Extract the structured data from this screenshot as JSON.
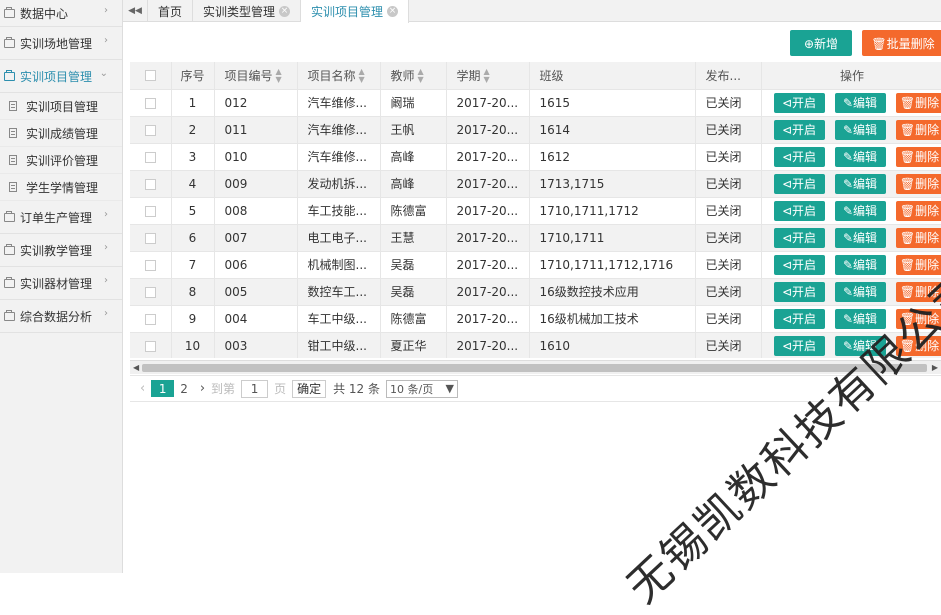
{
  "sidebar": {
    "items": [
      {
        "label": "数据中心",
        "arrow": "›"
      },
      {
        "label": "实训场地管理",
        "arrow": "›"
      },
      {
        "label": "实训项目管理",
        "arrow": "⌄",
        "active": true
      },
      {
        "label": "实训项目管理",
        "sub": true
      },
      {
        "label": "实训成绩管理",
        "sub": true
      },
      {
        "label": "实训评价管理",
        "sub": true
      },
      {
        "label": "学生学情管理",
        "sub": true
      },
      {
        "label": "订单生产管理",
        "arrow": "›"
      },
      {
        "label": "实训教学管理",
        "arrow": "›"
      },
      {
        "label": "实训器材管理",
        "arrow": "›"
      },
      {
        "label": "综合数据分析",
        "arrow": "›"
      }
    ]
  },
  "tabs": {
    "collapse_icon": "◀◀",
    "items": [
      {
        "label": "首页"
      },
      {
        "label": "实训类型管理",
        "close": "×"
      },
      {
        "label": "实训项目管理",
        "close": "×",
        "active": true
      }
    ]
  },
  "toolbar": {
    "add_label": "⊕新增",
    "batch_delete_label": "🗑批量删除"
  },
  "table": {
    "headers": [
      "",
      "序号",
      "项目编号",
      "项目名称",
      "教师",
      "学期",
      "班级",
      "发布...",
      "操作"
    ],
    "rows": [
      {
        "no": "1",
        "code": "012",
        "name": "汽车维修...",
        "teacher": "阚瑞",
        "term": "2017-20...",
        "class": "1615",
        "status": "已关闭"
      },
      {
        "no": "2",
        "code": "011",
        "name": "汽车维修...",
        "teacher": "王帆",
        "term": "2017-20...",
        "class": "1614",
        "status": "已关闭"
      },
      {
        "no": "3",
        "code": "010",
        "name": "汽车维修...",
        "teacher": "高峰",
        "term": "2017-20...",
        "class": "1612",
        "status": "已关闭"
      },
      {
        "no": "4",
        "code": "009",
        "name": "发动机拆...",
        "teacher": "高峰",
        "term": "2017-20...",
        "class": "1713,1715",
        "status": "已关闭"
      },
      {
        "no": "5",
        "code": "008",
        "name": "车工技能...",
        "teacher": "陈德富",
        "term": "2017-20...",
        "class": "1710,1711,1712",
        "status": "已关闭"
      },
      {
        "no": "6",
        "code": "007",
        "name": "电工电子...",
        "teacher": "王慧",
        "term": "2017-20...",
        "class": "1710,1711",
        "status": "已关闭"
      },
      {
        "no": "7",
        "code": "006",
        "name": "机械制图...",
        "teacher": "吴磊",
        "term": "2017-20...",
        "class": "1710,1711,1712,1716",
        "status": "已关闭"
      },
      {
        "no": "8",
        "code": "005",
        "name": "数控车工...",
        "teacher": "吴磊",
        "term": "2017-20...",
        "class": "16级数控技术应用",
        "status": "已关闭"
      },
      {
        "no": "9",
        "code": "004",
        "name": "车工中级...",
        "teacher": "陈德富",
        "term": "2017-20...",
        "class": "16级机械加工技术",
        "status": "已关闭"
      },
      {
        "no": "10",
        "code": "003",
        "name": "钳工中级...",
        "teacher": "夏正华",
        "term": "2017-20...",
        "class": "1610",
        "status": "已关闭"
      }
    ],
    "actions": {
      "open": "⊲开启",
      "edit": "✎编辑",
      "delete": "🗑删除"
    }
  },
  "pager": {
    "prev": "‹",
    "pages": [
      "1",
      "2"
    ],
    "next": "›",
    "goto_label": "到第",
    "goto_value": "1",
    "page_label": "页",
    "confirm": "确定",
    "total": "共 12 条",
    "page_size": "10 条/页",
    "page_size_caret": "▼"
  },
  "watermark": "无锡凯数科技有限公司",
  "colors": {
    "primary": "#1aa394",
    "danger": "#f4692c",
    "active_text": "#2d8fae"
  }
}
